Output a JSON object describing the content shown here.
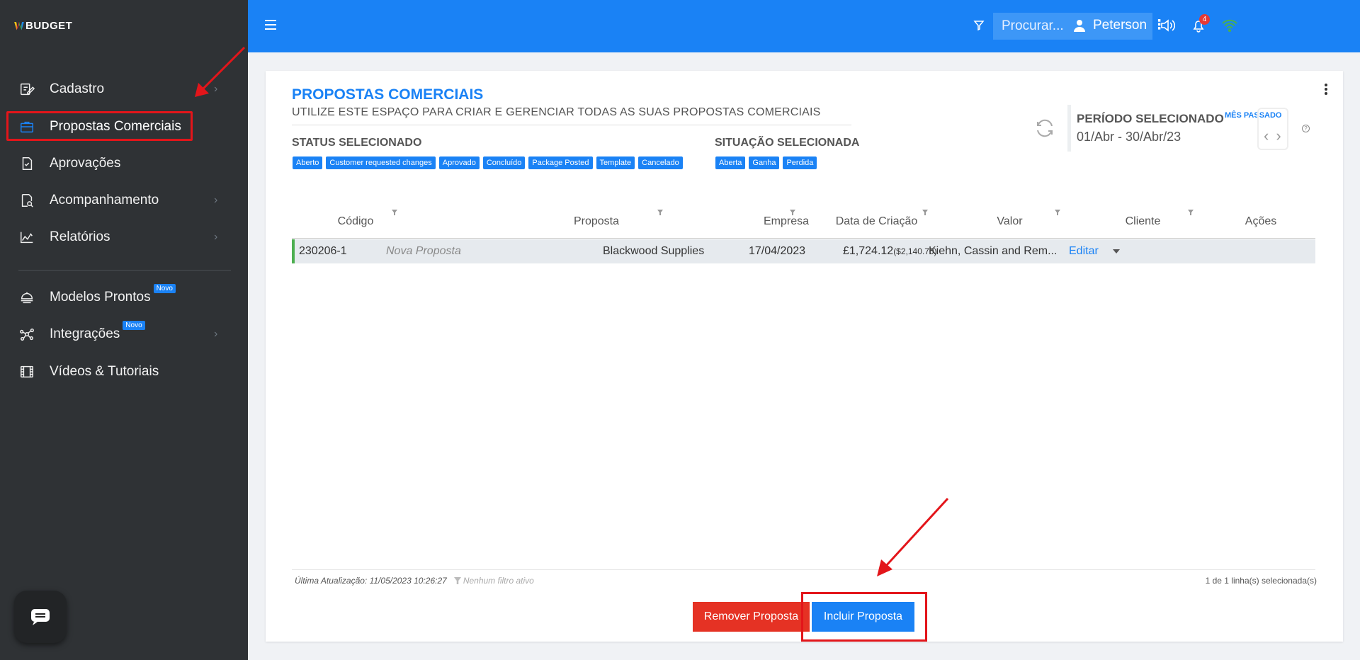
{
  "app": {
    "logo_prefix": "W",
    "logo_text": "BUDGET"
  },
  "sidebar": {
    "items": [
      {
        "label": "Cadastro",
        "icon": "edit-document-icon",
        "has_chevron": true
      },
      {
        "label": "Propostas Comerciais",
        "icon": "briefcase-icon",
        "has_chevron": false,
        "active": true
      },
      {
        "label": "Aprovações",
        "icon": "approval-check-icon",
        "has_chevron": false
      },
      {
        "label": "Acompanhamento",
        "icon": "document-search-icon",
        "has_chevron": true
      },
      {
        "label": "Relatórios",
        "icon": "area-chart-icon",
        "has_chevron": true
      },
      {
        "label": "Modelos Prontos",
        "icon": "bell-stack-icon",
        "badge": "Novo",
        "has_chevron": false
      },
      {
        "label": "Integrações",
        "icon": "network-icon",
        "badge": "Novo",
        "has_chevron": true
      },
      {
        "label": "Vídeos & Tutoriais",
        "icon": "film-icon",
        "has_chevron": false
      }
    ]
  },
  "topbar": {
    "search_placeholder": "Procurar...",
    "notification_count": "4",
    "user_name": "Peterson"
  },
  "page": {
    "title": "PROPOSTAS COMERCIAIS",
    "subtitle": "UTILIZE ESTE ESPAÇO PARA CRIAR E GERENCIAR TODAS AS SUAS PROPOSTAS COMERCIAIS",
    "status_heading": "STATUS SELECIONADO",
    "status_chips": [
      "Aberto",
      "Customer requested changes",
      "Aprovado",
      "Concluído",
      "Package Posted",
      "Template",
      "Cancelado"
    ],
    "situacao_heading": "SITUAÇÃO SELECIONADA",
    "situacao_chips": [
      "Aberta",
      "Ganha",
      "Perdida"
    ],
    "period_label": "PERÍODO SELECIONADO",
    "period_value": "01/Abr - 30/Abr/23",
    "period_shortcut": "MÊS PASSADO",
    "help": "?"
  },
  "table": {
    "columns": [
      "Código",
      "Proposta",
      "Empresa",
      "Data de Criação",
      "Valor",
      "Cliente",
      "Ações"
    ],
    "rows": [
      {
        "codigo": "230206-1",
        "proposta": "Nova Proposta",
        "empresa": "Blackwood Supplies",
        "data": "17/04/2023",
        "valor": "£1,724.12",
        "valor_alt": "($2,140.70)",
        "cliente": "Kiehn, Cassin and Rem...",
        "acao": "Editar"
      }
    ]
  },
  "footer": {
    "last_update": "Última Atualização: 11/05/2023 10:26:27",
    "filter_status": "Nenhum filtro ativo",
    "selection": "1 de 1 linha(s) selecionada(s)"
  },
  "actions": {
    "remove_label": "Remover Proposta",
    "add_label": "Incluir Proposta"
  },
  "colors": {
    "primary": "#1a82f5",
    "danger": "#e53224",
    "sidebar_bg": "#2f3235",
    "annotation_red": "#e3151a"
  }
}
